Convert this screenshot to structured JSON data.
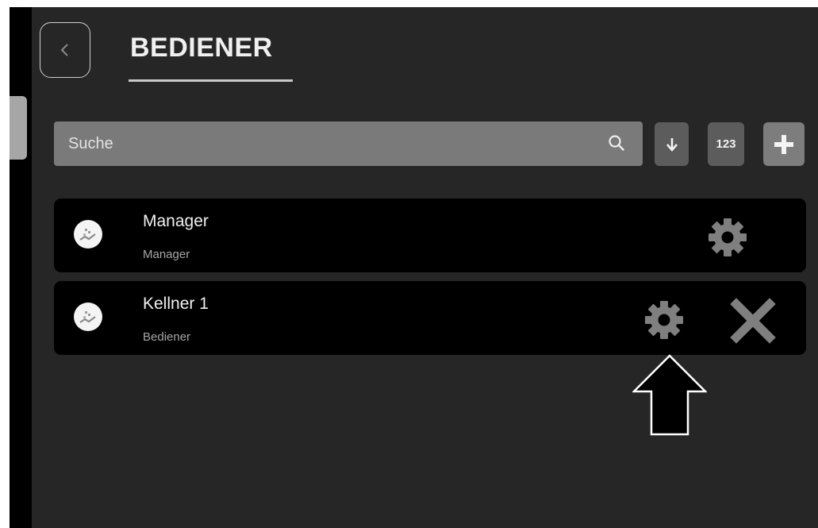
{
  "header": {
    "title": "BEDIENER"
  },
  "search": {
    "placeholder": "Suche"
  },
  "toolbar": {
    "number_sort_label": "123"
  },
  "users": [
    {
      "name": "Manager",
      "role": "Manager"
    },
    {
      "name": "Kellner 1",
      "role": "Bediener"
    }
  ],
  "icons": {
    "back": "chevron-left-icon",
    "search": "search-icon",
    "sort": "arrow-down-icon",
    "add": "plus-icon",
    "settings": "gear-icon",
    "delete": "close-icon",
    "annotation": "up-arrow-icon"
  },
  "colors": {
    "background": "#262626",
    "row": "#000000",
    "search_bar": "#7a7a7a",
    "button": "#5c5c5c",
    "icon": "#7f7f7f"
  }
}
